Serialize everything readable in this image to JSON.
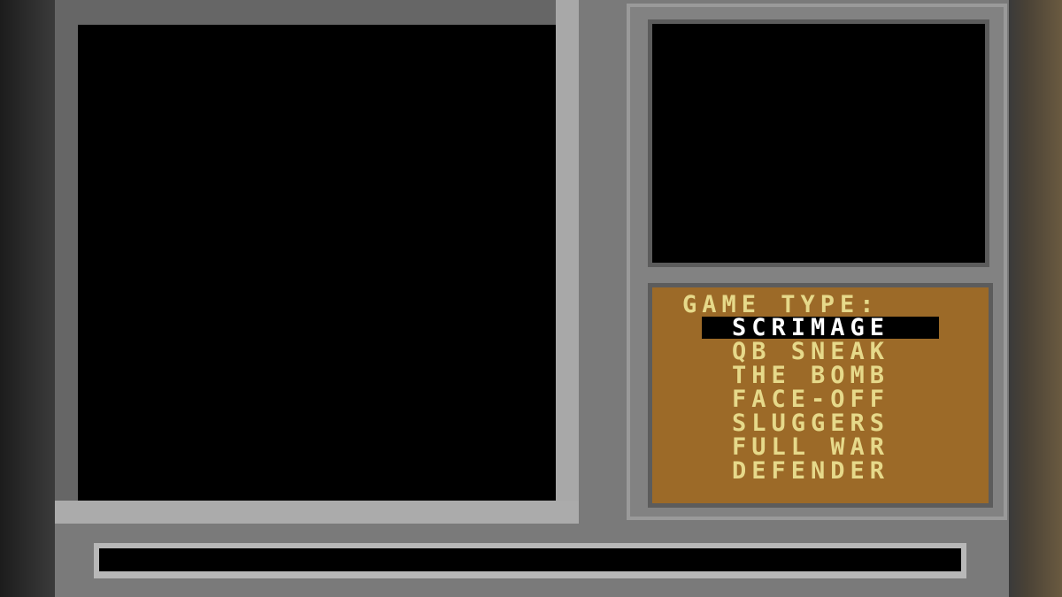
{
  "menu": {
    "title": "GAME TYPE:",
    "selected_index": 0,
    "items": [
      {
        "label": "SCRIMAGE"
      },
      {
        "label": "QB SNEAK"
      },
      {
        "label": "THE BOMB"
      },
      {
        "label": "FACE-OFF"
      },
      {
        "label": "SLUGGERS"
      },
      {
        "label": "FULL WAR"
      },
      {
        "label": "DEFENDER"
      }
    ]
  },
  "colors": {
    "menu_background": "#9c6a28",
    "menu_text": "#e6d98a",
    "selected_text": "#ffffff",
    "selection_bar": "#000000",
    "frame_gray": "#7a7a7a"
  }
}
